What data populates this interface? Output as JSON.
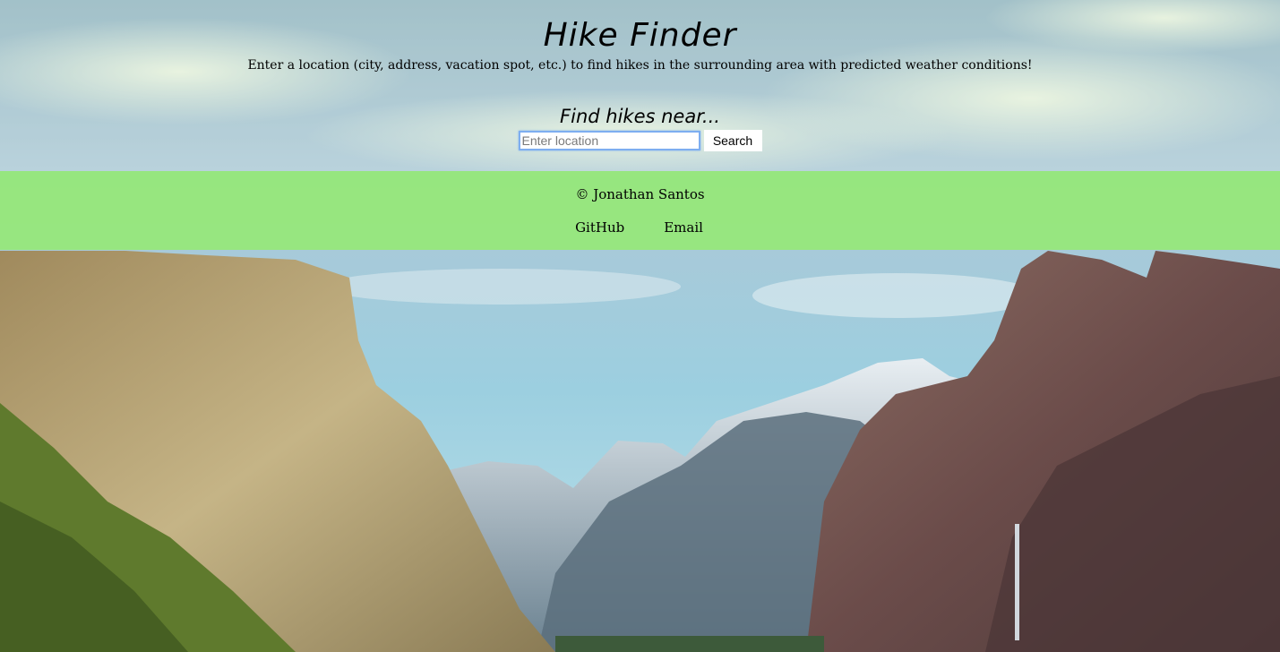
{
  "header": {
    "title": "Hike Finder",
    "subtitle": "Enter a location (city, address, vacation spot, etc.) to find hikes in the surrounding area with predicted weather conditions!"
  },
  "search": {
    "heading": "Find hikes near...",
    "placeholder": "Enter location",
    "value": "",
    "button_label": "Search"
  },
  "footer": {
    "copyright": "© Jonathan Santos",
    "links": [
      {
        "label": "GitHub"
      },
      {
        "label": "Email"
      }
    ],
    "background_color": "#96e878"
  },
  "background": {
    "description_icon": "mountain-valley-photo"
  }
}
